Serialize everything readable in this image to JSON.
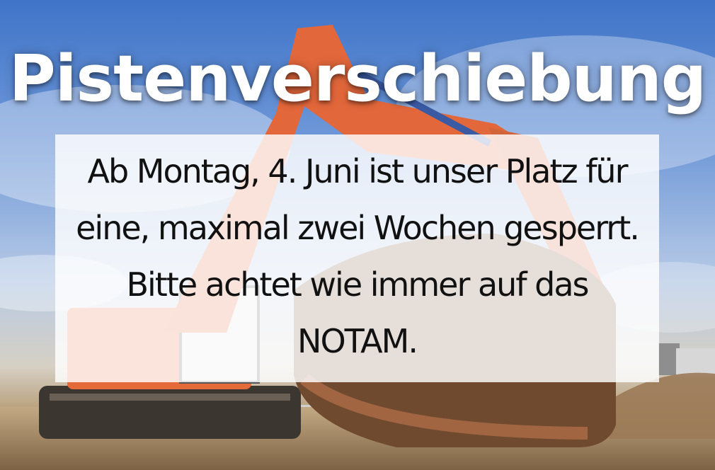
{
  "headline": "Pistenverschiebung",
  "notice": {
    "lines": [
      "Ab Montag, 4. Juni ist unser Platz für",
      "eine, maximal zwei Wochen gesperrt.",
      "Bitte achtet wie immer auf das",
      "NOTAM."
    ]
  },
  "colors": {
    "sky": "#4f84d2",
    "excavator": "#e56a3a",
    "ground": "#a6875f",
    "headline_text": "#ffffff",
    "notice_text": "#111111"
  }
}
